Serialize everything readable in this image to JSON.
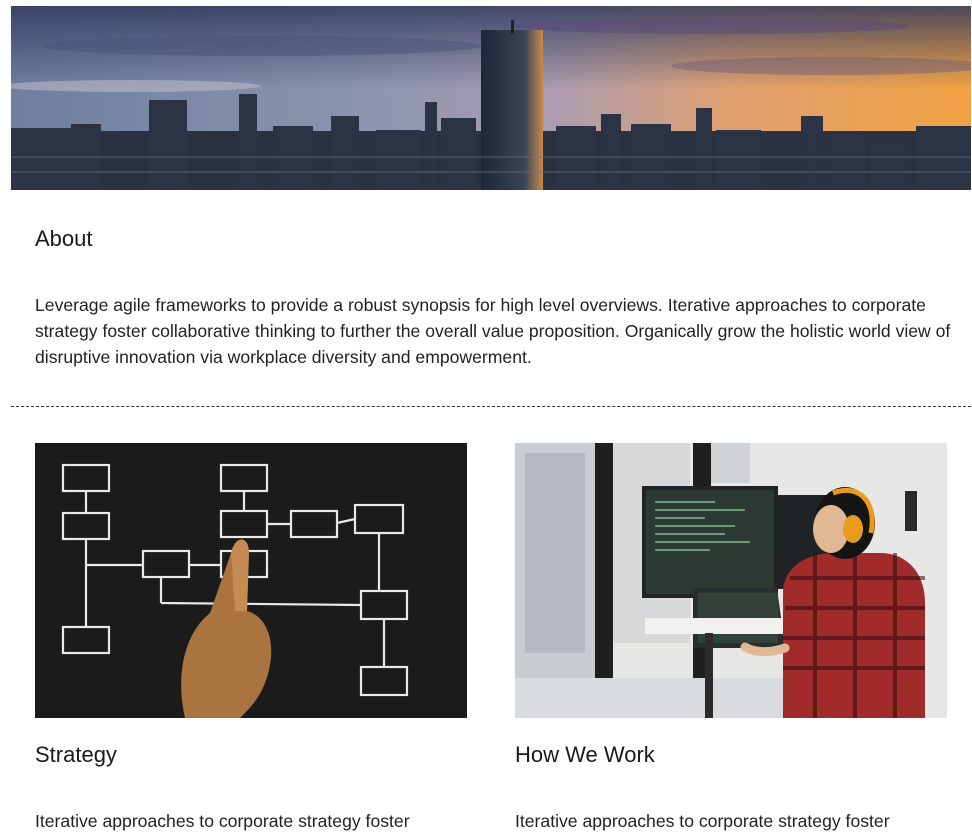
{
  "hero": {
    "image_icon": "city-skyline-sunset-image"
  },
  "about": {
    "title": "About",
    "body": "Leverage agile frameworks to provide a robust synopsis for high level overviews. Iterative approaches to corporate strategy foster collaborative thinking to further the overall value proposition. Organically grow the holistic world view of disruptive innovation via workplace diversity and empowerment."
  },
  "cards": [
    {
      "title": "Strategy",
      "body": "Iterative approaches to corporate strategy foster",
      "image_icon": "flowchart-hand-image"
    },
    {
      "title": "How We Work",
      "body": "Iterative approaches to corporate strategy foster",
      "image_icon": "developer-at-desk-image"
    }
  ],
  "colors": {
    "text": "#1f1f1f",
    "divider": "#333333",
    "background": "#ffffff"
  }
}
